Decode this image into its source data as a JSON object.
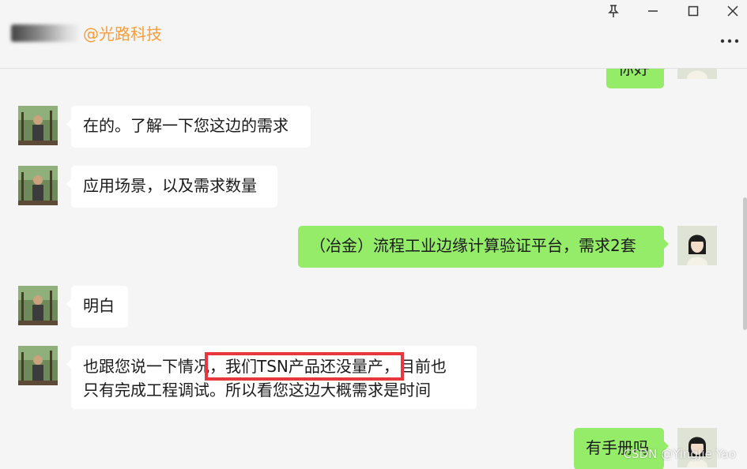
{
  "header": {
    "title": "@光路科技",
    "pin_icon": "pin-icon",
    "minimize_icon": "minimize-icon",
    "maximize_icon": "maximize-icon",
    "close_icon": "close-icon",
    "more_icon": "more-icon"
  },
  "messages": [
    {
      "side": "out",
      "text": "你好"
    },
    {
      "side": "in",
      "text": "在的。了解一下您这边的需求"
    },
    {
      "side": "in",
      "text": "应用场景，以及需求数量"
    },
    {
      "side": "out",
      "text": "（冶金）流程工业边缘计算验证平台，需求2套"
    },
    {
      "side": "in",
      "text": "明白"
    },
    {
      "side": "in",
      "line1_before": "也跟您说一下情况",
      "line1_highlight": "，我们TSN产品还没量产，",
      "line1_after": "目前也",
      "line2": "只有完成工程调试。所以看您这边大概需求是时间"
    },
    {
      "side": "out",
      "text": "有手册吗"
    }
  ],
  "watermark": "CSDN @YingJie Yao",
  "colors": {
    "accent_orange": "#fa9d3b",
    "bubble_out": "#95ec69",
    "bubble_in": "#ffffff",
    "highlight_red": "#e8383d"
  }
}
